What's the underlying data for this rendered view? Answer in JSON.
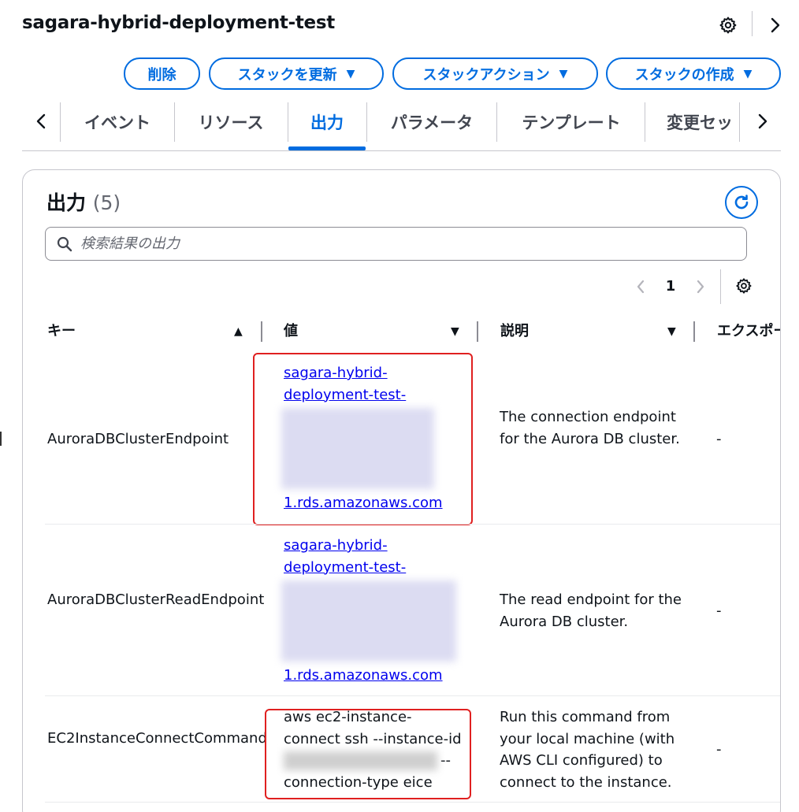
{
  "header": {
    "title": "sagara-hybrid-deployment-test"
  },
  "actions": {
    "delete_label": "削除",
    "update_label": "スタックを更新",
    "stack_actions_label": "スタックアクション",
    "create_label": "スタックの作成"
  },
  "tabs": [
    {
      "label": "イベント"
    },
    {
      "label": "リソース"
    },
    {
      "label": "出力"
    },
    {
      "label": "パラメータ"
    },
    {
      "label": "テンプレート"
    },
    {
      "label": "変更セッ"
    }
  ],
  "panel": {
    "title": "出力",
    "count": "(5)",
    "search_placeholder": "検索結果の出力",
    "page": "1"
  },
  "table": {
    "columns": {
      "key": "キー",
      "value": "値",
      "description": "説明",
      "export": "エクスポー"
    },
    "rows": [
      {
        "key": "AuroraDBClusterEndpoint",
        "value_line1": "sagara-hybrid-",
        "value_line2": "deployment-test-",
        "value_last": "1.rds.amazonaws.com",
        "description": "The connection endpoint for the Aurora DB cluster.",
        "export": "-"
      },
      {
        "key": "AuroraDBClusterReadEndpoint",
        "value_line1": "sagara-hybrid-",
        "value_line2": "deployment-test-",
        "value_last": "1.rds.amazonaws.com",
        "description": "The read endpoint for the Aurora DB cluster.",
        "export": "-"
      },
      {
        "key": "EC2InstanceConnectCommand",
        "value_line1": "aws ec2-instance-",
        "value_line2": "connect ssh --instance-id",
        "value_line3_suffix": "--",
        "value_line4": "connection-type eice",
        "description": "Run this command from your local machine (with AWS CLI configured) to connect to the instance.",
        "export": "-"
      }
    ]
  }
}
